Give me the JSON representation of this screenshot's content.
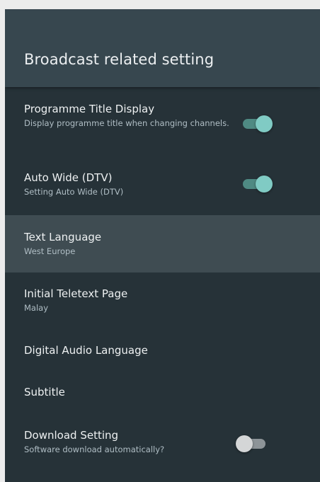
{
  "header": {
    "title": "Broadcast related setting"
  },
  "items": [
    {
      "title": "Programme Title Display",
      "subtitle": "Display programme title when changing channels.",
      "toggle": "on"
    },
    {
      "title": "Auto Wide (DTV)",
      "subtitle": "Setting Auto Wide (DTV)",
      "toggle": "on"
    },
    {
      "title": "Text Language",
      "subtitle": "West Europe",
      "selected": true
    },
    {
      "title": "Initial Teletext Page",
      "subtitle": "Malay"
    },
    {
      "title": "Digital Audio Language"
    },
    {
      "title": "Subtitle"
    },
    {
      "title": "Download Setting",
      "subtitle": "Software download automatically?",
      "toggle": "off"
    }
  ],
  "colors": {
    "panel": "#263238",
    "header": "#37474f",
    "selected_row": "#3f4c52",
    "toggle_on": "#80cbc4",
    "toggle_off": "#d4d6d7"
  }
}
